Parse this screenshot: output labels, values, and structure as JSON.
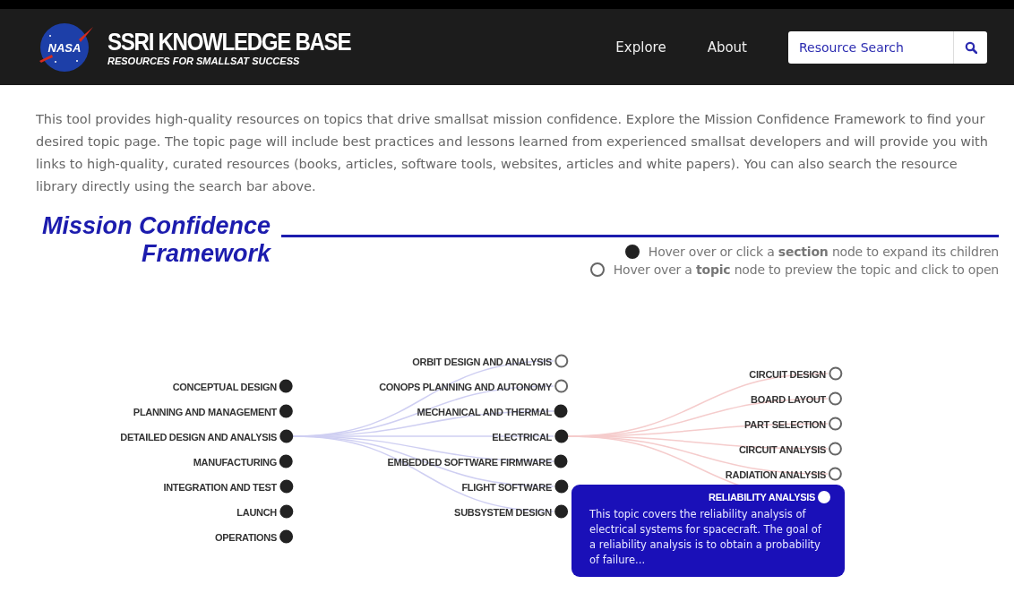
{
  "header": {
    "logo_text": "NASA",
    "title": "SSRI KNOWLEDGE BASE",
    "subtitle": "RESOURCES FOR SMALLSAT SUCCESS",
    "nav": [
      {
        "label": "Explore"
      },
      {
        "label": "About"
      }
    ],
    "search": {
      "placeholder": "Resource Search"
    }
  },
  "intro": "This tool provides high-quality resources on topics that drive smallsat mission confidence. Explore the Mission Confidence Framework to find your desired topic page. The topic page will include best practices and lessons learned from experienced smallsat developers and will provide you with links to high-quality, curated resources (books, articles, software tools, websites, articles and white papers). You can also search the resource library directly using the search bar above.",
  "framework": {
    "title_lines": [
      "Mission Confidence",
      "Framework"
    ],
    "legend": [
      {
        "kind": "section",
        "text": "Hover over or click a **section** node to expand its children"
      },
      {
        "kind": "topic",
        "text": "Hover over a **topic** node to preview the topic and click to open"
      }
    ],
    "tree": [
      {
        "label": "CONCEPTUAL DESIGN",
        "kind": "section"
      },
      {
        "label": "PLANNING AND MANAGEMENT",
        "kind": "section"
      },
      {
        "label": "DETAILED DESIGN AND ANALYSIS",
        "kind": "section",
        "children": [
          {
            "label": "ORBIT DESIGN AND ANALYSIS",
            "kind": "topic"
          },
          {
            "label": "CONOPS PLANNING AND AUTONOMY",
            "kind": "topic"
          },
          {
            "label": "MECHANICAL AND THERMAL",
            "kind": "section"
          },
          {
            "label": "ELECTRICAL",
            "kind": "section",
            "children": [
              {
                "label": "CIRCUIT DESIGN",
                "kind": "topic"
              },
              {
                "label": "BOARD LAYOUT",
                "kind": "topic"
              },
              {
                "label": "PART SELECTION",
                "kind": "topic"
              },
              {
                "label": "CIRCUIT ANALYSIS",
                "kind": "topic"
              },
              {
                "label": "RADIATION ANALYSIS",
                "kind": "topic"
              },
              {
                "label": "RELIABILITY ANALYSIS",
                "kind": "topic",
                "preview": "This topic covers the reliability analysis of electrical systems for spacecraft. The goal of a reliability analysis is to obtain a probability of failure..."
              }
            ]
          },
          {
            "label": "EMBEDDED SOFTWARE FIRMWARE",
            "kind": "section"
          },
          {
            "label": "FLIGHT SOFTWARE",
            "kind": "section"
          },
          {
            "label": "SUBSYSTEM DESIGN",
            "kind": "section"
          }
        ]
      },
      {
        "label": "MANUFACTURING",
        "kind": "section"
      },
      {
        "label": "INTEGRATION AND TEST",
        "kind": "section"
      },
      {
        "label": "LAUNCH",
        "kind": "section"
      },
      {
        "label": "OPERATIONS",
        "kind": "section"
      }
    ]
  }
}
